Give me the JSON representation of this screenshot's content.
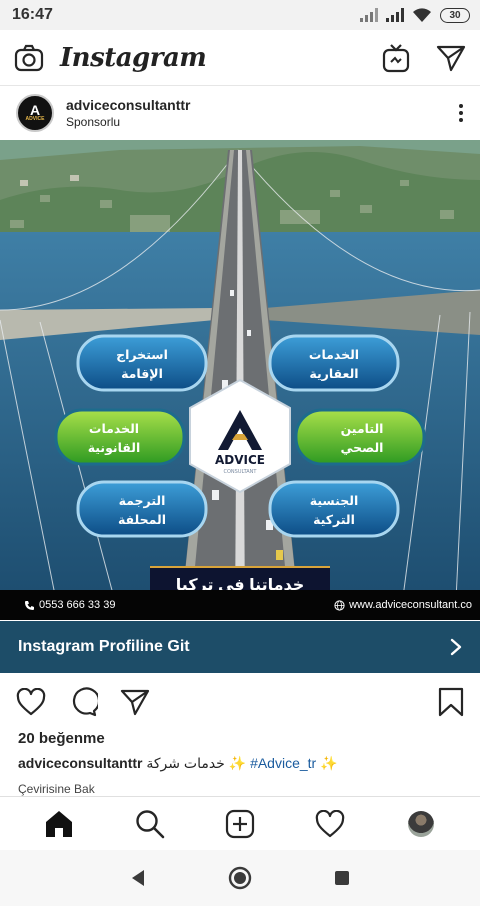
{
  "status_bar": {
    "time": "16:47",
    "battery": "30"
  },
  "app": {
    "title": "Instagram"
  },
  "post": {
    "username": "adviceconsultanttr",
    "sponsored": "Sponsorlu",
    "avatar_text": "A",
    "avatar_subtext": "ADVICE"
  },
  "ad_image": {
    "pills": [
      "استخراج",
      "الإقامة",
      "الخدمات",
      "العقارية",
      "الخدمات",
      "القانونية",
      "التامين",
      "الصحي",
      "الترجمة",
      "المحلفة",
      "الجنسية",
      "التركية"
    ],
    "logo_brand": "ADVICE",
    "logo_sub": "CONSULTANT",
    "banner": "خدماتنا في تركيا",
    "phone": "0553 666 33 39",
    "website": "www.adviceconsultant.co"
  },
  "cta": {
    "label": "Instagram Profiline Git"
  },
  "likes": "20 beğenme",
  "caption": {
    "username": "adviceconsultanttr",
    "text": "خدمات شركة",
    "sparkle": "✨",
    "hashtag": "#Advice_tr"
  },
  "translate": "Çevirisine Bak",
  "colors": {
    "cta_bg": "#1d4d68",
    "banner_bg": "#0d1430",
    "gold": "#d9a43a"
  }
}
